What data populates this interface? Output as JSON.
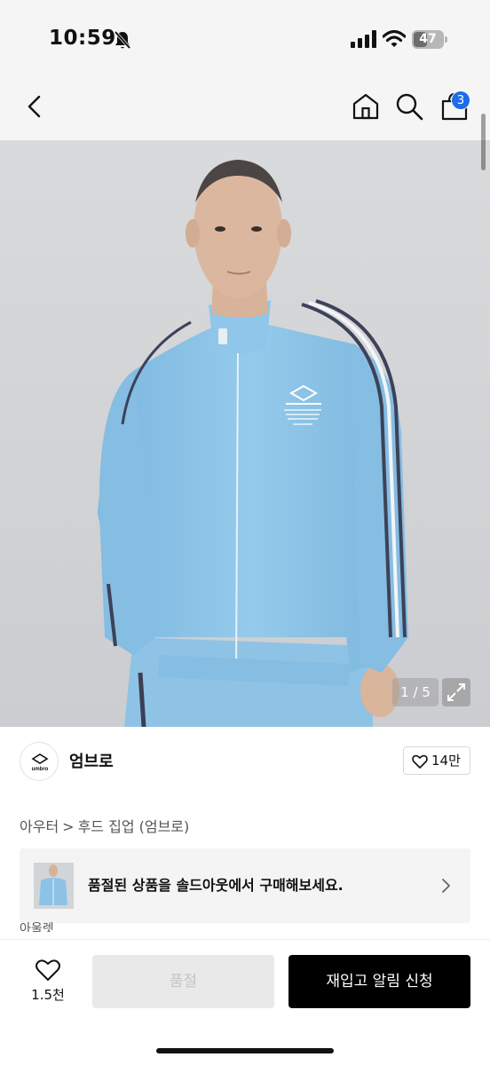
{
  "status_bar": {
    "time": "10:59",
    "battery": "47",
    "battery_level": 0.47
  },
  "header": {
    "cart_count": "3",
    "icons": [
      "back-icon",
      "home-icon",
      "search-icon",
      "cart-icon"
    ]
  },
  "product_image": {
    "counter": "1 / 5"
  },
  "brand": {
    "name": "엄브로",
    "logo_text": "umbro",
    "likes": "14만"
  },
  "breadcrumb": {
    "items": [
      "아우터",
      "후드 집업 (엄브로)"
    ],
    "separator": ">"
  },
  "soldout_banner": {
    "text": "품절된 상품을 솔드아웃에서 구매해보세요."
  },
  "partial_label": "아울렛",
  "bottom_bar": {
    "wish_count": "1.5천",
    "soldout_label": "품절",
    "restock_label": "재입고 알림 신청"
  },
  "colors": {
    "accent_badge": "#1e6ce9",
    "jacket": "#8cc2e6",
    "primary_button": "#000000"
  }
}
